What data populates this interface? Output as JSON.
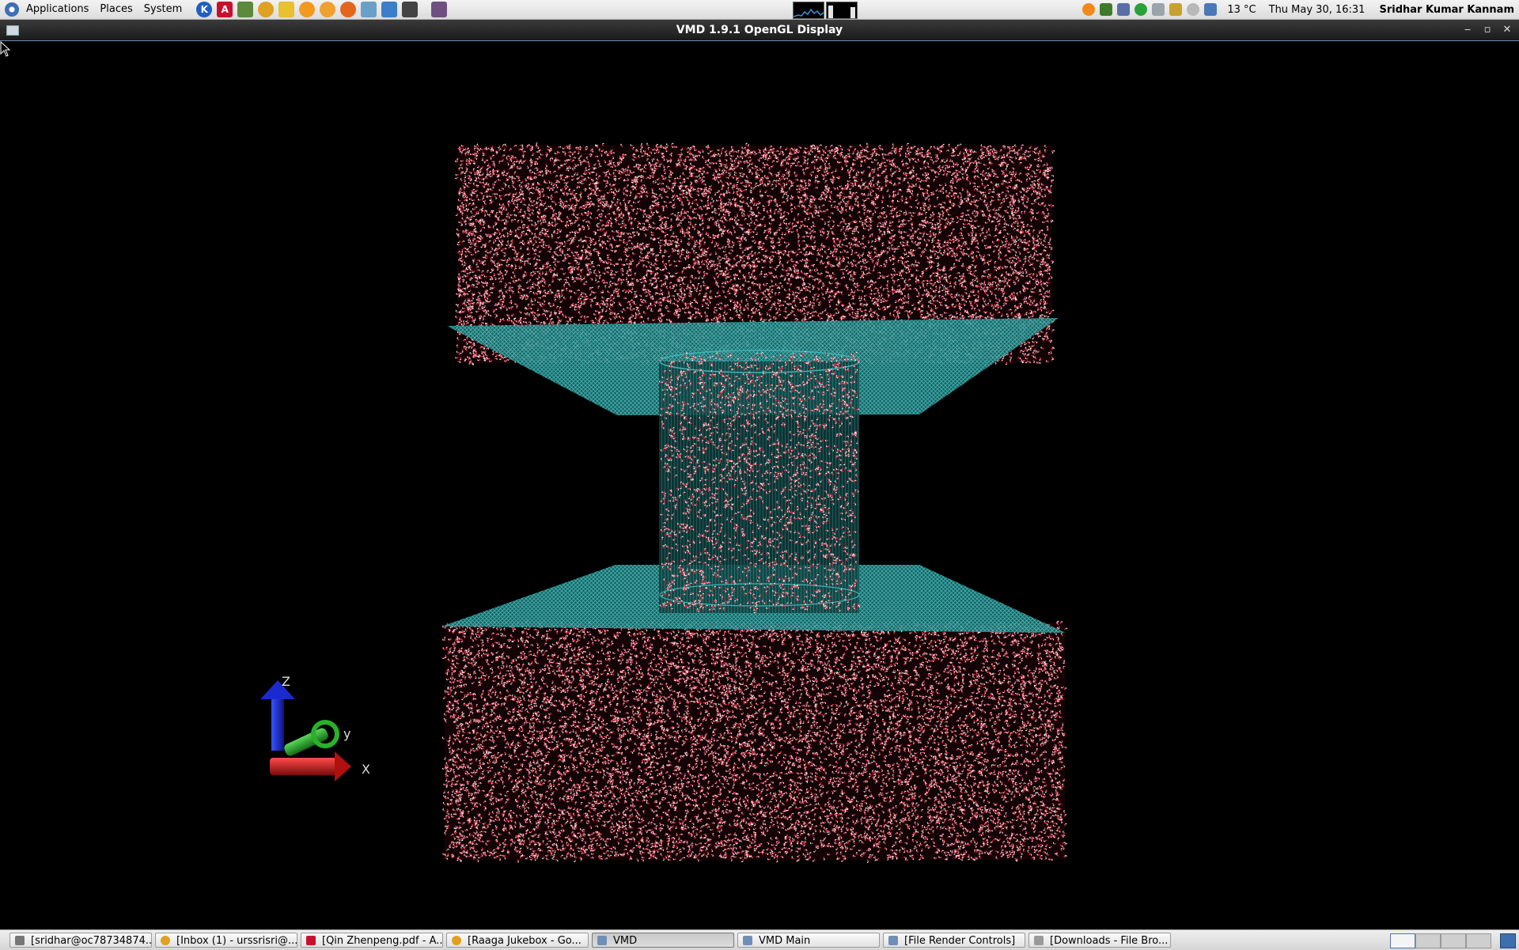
{
  "top_panel": {
    "menus": [
      "Applications",
      "Places",
      "System"
    ],
    "launchers": [
      {
        "icon": "k-icon",
        "glyph": "K",
        "color": "#1f5fbf"
      },
      {
        "icon": "pdf-reader-icon",
        "glyph": "A",
        "color": "#c8102e"
      },
      {
        "icon": "system-monitor-icon",
        "glyph": "",
        "color": "#5a8a3a"
      },
      {
        "icon": "chrome-icon",
        "glyph": "",
        "color": "#e0a020"
      },
      {
        "icon": "text-editor-icon",
        "glyph": "",
        "color": "#e8c030"
      },
      {
        "icon": "media-player-icon",
        "glyph": "",
        "color": "#f29a1f"
      },
      {
        "icon": "chat-icon",
        "glyph": "",
        "color": "#f0a030"
      },
      {
        "icon": "firefox-icon",
        "glyph": "",
        "color": "#e2661d"
      },
      {
        "icon": "image-viewer-icon",
        "glyph": "",
        "color": "#6aa0c8"
      },
      {
        "icon": "spreadsheet-icon",
        "glyph": "",
        "color": "#3a7fc8"
      },
      {
        "icon": "terminal-icon",
        "glyph": "",
        "color": "#444444"
      },
      {
        "icon": "graph-plot-icon",
        "glyph": "",
        "color": "#705080"
      }
    ],
    "weather": "13 °C",
    "clock": "Thu May 30, 16:31",
    "user": "Sridhar Kumar Kannam"
  },
  "window": {
    "title": "VMD 1.9.1 OpenGL Display",
    "controls": [
      "minimize-icon",
      "maximize-icon",
      "close-icon"
    ]
  },
  "axes": {
    "z": "Z",
    "y": "y",
    "x": "X"
  },
  "colors": {
    "water_oxygen": "#d63a4a",
    "water_hydrogen": "#f2f2f2",
    "membrane": "#35b5b5",
    "axis_x": "#cc2020",
    "axis_y": "#20a030",
    "axis_z": "#1a2ad0"
  },
  "taskbar": {
    "tasks": [
      {
        "label": "[sridhar@oc78734874...",
        "icon": "terminal-icon",
        "active": false
      },
      {
        "label": "[Inbox (1) - urssrisri@...",
        "icon": "chrome-icon",
        "active": false
      },
      {
        "label": "[Qin Zhenpeng.pdf - A...",
        "icon": "pdf-reader-icon",
        "active": false
      },
      {
        "label": "[Raaga Jukebox - Go...",
        "icon": "chrome-icon",
        "active": false
      },
      {
        "label": "VMD",
        "icon": "window-icon",
        "active": true
      },
      {
        "label": "VMD Main",
        "icon": "window-icon",
        "active": false
      },
      {
        "label": "[File Render Controls]",
        "icon": "window-icon",
        "active": false
      },
      {
        "label": "[Downloads - File Bro...",
        "icon": "folder-icon",
        "active": false
      }
    ],
    "workspaces": 4,
    "active_workspace": 1
  }
}
